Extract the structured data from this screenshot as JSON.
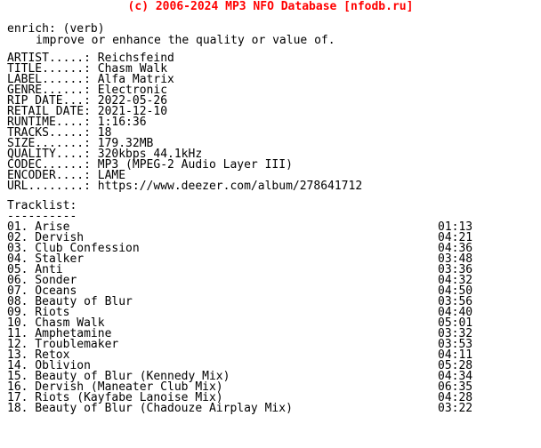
{
  "header": {
    "copyright": "(c) 2006-2024 MP3 NFO Database [nfodb.ru]",
    "color": "#ff0000"
  },
  "definition": {
    "term": "enrich: (verb)",
    "description": "improve or enhance the quality or value of."
  },
  "release_info": {
    "fields": [
      {
        "label": "ARTIST.....:",
        "value": "Reichsfeind"
      },
      {
        "label": "TITLE......:",
        "value": "Chasm Walk"
      },
      {
        "label": "LABEL......:",
        "value": "Alfa Matrix"
      },
      {
        "label": "GENRE......:",
        "value": "Electronic"
      },
      {
        "label": "RIP DATE...:",
        "value": "2022-05-26"
      },
      {
        "label": "RETAIL DATE:",
        "value": "2021-12-10"
      },
      {
        "label": "RUNTIME....:",
        "value": "1:16:36"
      },
      {
        "label": "TRACKS.....:",
        "value": "18"
      },
      {
        "label": "SIZE.......:",
        "value": "179.32MB"
      },
      {
        "label": "QUALITY....:",
        "value": "320kbps 44.1kHz"
      },
      {
        "label": "CODEC......:",
        "value": "MP3 (MPEG-2 Audio Layer III)"
      },
      {
        "label": "ENCODER....:",
        "value": "LAME"
      },
      {
        "label": "URL........:",
        "value": "https://www.deezer.com/album/278641712"
      }
    ]
  },
  "tracklist": {
    "title": "Tracklist:",
    "rule": "----------",
    "tracks": [
      {
        "num": "01.",
        "title": "Arise",
        "time": "01:13"
      },
      {
        "num": "02.",
        "title": "Dervish",
        "time": "04:21"
      },
      {
        "num": "03.",
        "title": "Club Confession",
        "time": "04:36"
      },
      {
        "num": "04.",
        "title": "Stalker",
        "time": "03:48"
      },
      {
        "num": "05.",
        "title": "Anti",
        "time": "03:36"
      },
      {
        "num": "06.",
        "title": "Sonder",
        "time": "04:32"
      },
      {
        "num": "07.",
        "title": "Oceans",
        "time": "04:50"
      },
      {
        "num": "08.",
        "title": "Beauty of Blur",
        "time": "03:56"
      },
      {
        "num": "09.",
        "title": "Riots",
        "time": "04:40"
      },
      {
        "num": "10.",
        "title": "Chasm Walk",
        "time": "05:01"
      },
      {
        "num": "11.",
        "title": "Amphetamine",
        "time": "03:32"
      },
      {
        "num": "12.",
        "title": "Troublemaker",
        "time": "03:53"
      },
      {
        "num": "13.",
        "title": "Retox",
        "time": "04:11"
      },
      {
        "num": "14.",
        "title": "Oblivion",
        "time": "05:28"
      },
      {
        "num": "15.",
        "title": "Beauty of Blur (Kennedy Mix)",
        "time": "04:34"
      },
      {
        "num": "16.",
        "title": "Dervish (Maneater Club Mix)",
        "time": "06:35"
      },
      {
        "num": "17.",
        "title": "Riots (Kayfabe Lanoise Mix)",
        "time": "04:28"
      },
      {
        "num": "18.",
        "title": "Beauty of Blur (Chadouze Airplay Mix)",
        "time": "03:22"
      }
    ]
  }
}
